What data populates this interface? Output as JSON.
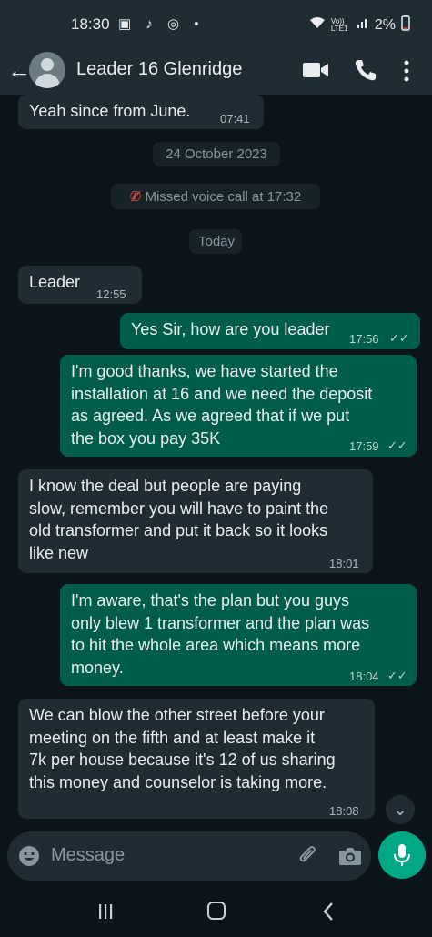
{
  "status_bar": {
    "time": "18:30",
    "left_icons": [
      "gallery-icon",
      "tiktok-icon",
      "instagram-threads-icon",
      "dot-icon"
    ],
    "network": "Vo)) LTE1",
    "battery": "2%"
  },
  "header": {
    "contact_name": "Leader 16 Glenridge",
    "actions": [
      "video-call-icon",
      "voice-call-icon",
      "more-options-icon"
    ]
  },
  "messages": [
    {
      "direction": "in",
      "text": "Yeah since from June.",
      "time": "07:41"
    },
    {
      "type": "date",
      "text": "24 October 2023"
    },
    {
      "type": "missed_call",
      "text": "Missed voice call at 17:32"
    },
    {
      "type": "date",
      "text": "Today"
    },
    {
      "direction": "in",
      "text": "Leader",
      "time": "12:55"
    },
    {
      "direction": "out",
      "text": "Yes Sir, how are you leader",
      "time": "17:56"
    },
    {
      "direction": "out",
      "lines": [
        "I'm good thanks, we have started the",
        "installation at 16 and we need the deposit",
        "as agreed. As we agreed that if we put",
        "the box you pay 35K"
      ],
      "time": "17:59"
    },
    {
      "direction": "in",
      "lines": [
        "I know the deal but people are paying",
        "slow, remember you will have to paint the",
        "old transformer and put it back so it looks",
        "like new"
      ],
      "time": "18:01"
    },
    {
      "direction": "out",
      "lines": [
        "I'm aware, that's the plan but  you guys",
        "only blew 1 transformer and the plan was",
        "to hit the whole area which means more",
        "money."
      ],
      "time": "18:04"
    },
    {
      "direction": "in",
      "lines": [
        "We can blow the other street before your",
        "meeting on the fifth and at least make it",
        "7k per house because it's 12 of us sharing",
        "this money and counselor is taking more."
      ],
      "time": "18:08"
    }
  ],
  "composer": {
    "placeholder": "Message"
  },
  "colors": {
    "background": "#0b141a",
    "incoming_bubble": "#202c33",
    "outgoing_bubble": "#005c4b",
    "accent": "#00a884"
  }
}
